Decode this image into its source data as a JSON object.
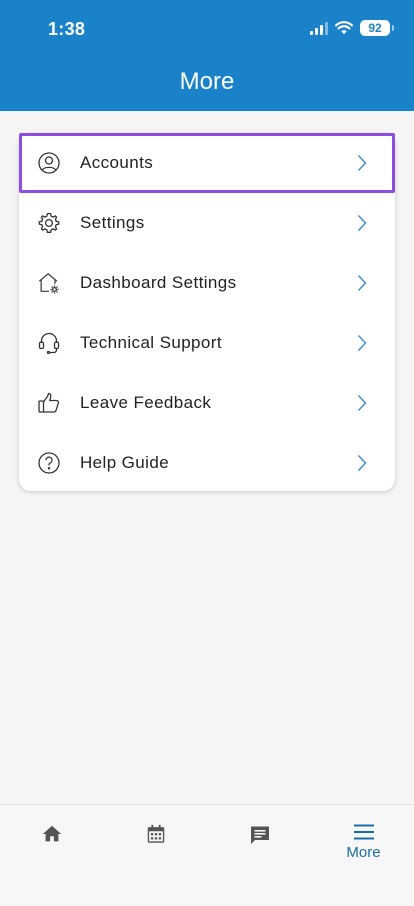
{
  "status_bar": {
    "time": "1:38",
    "battery": "92"
  },
  "header": {
    "title": "More",
    "background_color": "#1a82c8"
  },
  "menu": {
    "highlight_color": "#8a4fe0",
    "items": [
      {
        "label": "Accounts",
        "icon": "user-circle-icon"
      },
      {
        "label": "Settings",
        "icon": "gear-icon"
      },
      {
        "label": "Dashboard Settings",
        "icon": "house-gear-icon"
      },
      {
        "label": "Technical Support",
        "icon": "headset-icon"
      },
      {
        "label": "Leave Feedback",
        "icon": "thumbs-up-icon"
      },
      {
        "label": "Help Guide",
        "icon": "question-circle-icon"
      }
    ]
  },
  "bottom_nav": {
    "tabs": [
      {
        "icon": "home-icon",
        "label": ""
      },
      {
        "icon": "calendar-icon",
        "label": ""
      },
      {
        "icon": "message-icon",
        "label": ""
      },
      {
        "icon": "menu-icon",
        "label": "More",
        "active": true
      }
    ]
  }
}
